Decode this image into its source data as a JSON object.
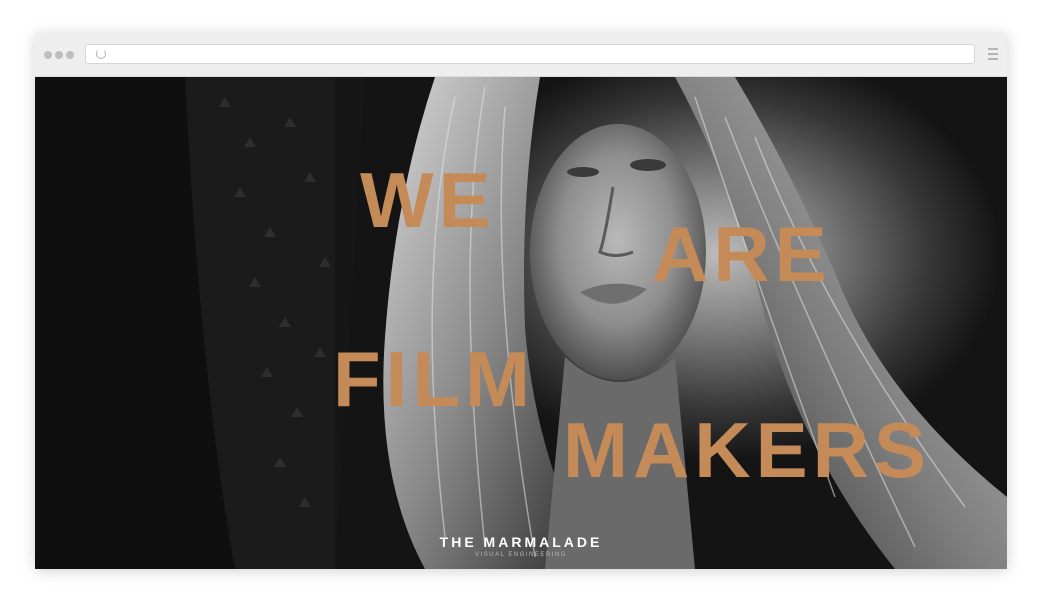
{
  "browser": {
    "address_bar": {
      "value": ""
    },
    "icons": {
      "window_controls": "window-dots-icon",
      "reload": "reload-icon",
      "menu": "hamburger-menu-icon"
    }
  },
  "hero": {
    "headline": [
      "WE",
      "ARE",
      "FILM",
      "MAKERS"
    ],
    "brand_name": "THE MARMALADE",
    "brand_tagline": "VISUAL ENGINEERING",
    "photo": "black-and-white portrait of a woman with long wavy hair"
  },
  "colors": {
    "headline": "#c48a58",
    "background": "#0f0f0f",
    "brand_text": "#ffffff",
    "browser_chrome": "#eeeeee"
  }
}
